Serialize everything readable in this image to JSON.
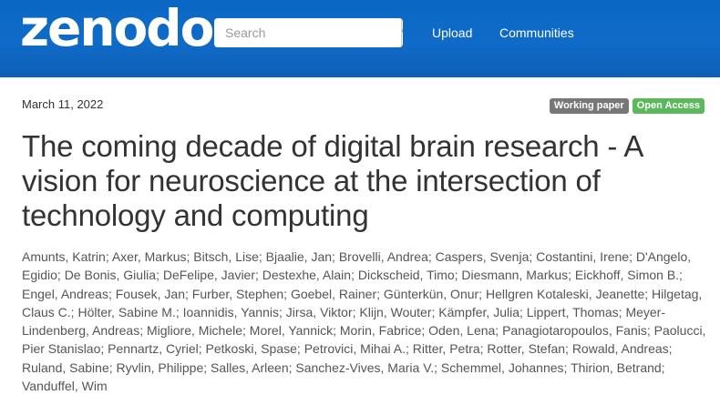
{
  "header": {
    "logo": "zenodo",
    "search": {
      "placeholder": "Search",
      "value": ""
    },
    "nav": [
      "Upload",
      "Communities"
    ]
  },
  "record": {
    "date": "March 11, 2022",
    "badges": [
      "Working paper",
      "Open Access"
    ],
    "title": "The coming decade of digital brain research - A vision for neuroscience at the intersection of technology and computing",
    "authors_text": "Amunts, Katrin; Axer, Markus; Bitsch, Lise; Bjaalie, Jan; Brovelli, Andrea; Caspers, Svenja; Costantini, Irene; D'Angelo, Egidio; De Bonis, Giulia; DeFelipe, Javier; Destexhe, Alain; Dickscheid, Timo; Diesmann, Markus; Eickhoff, Simon B.; Engel, Andreas; Fousek, Jan; Furber, Stephen; Goebel, Rainer; Günterkün, Onur; Hellgren Kotaleski, Jeanette; Hilgetag, Claus C.; Hölter, Sabine M.; Ioannidis, Yannis; Jirsa, Viktor; Klijn, Wouter; Kämpfer, Julia; Lippert, Thomas; Meyer-Lindenberg, Andreas; Migliore, Michele; Morel, Yannick; Morin, Fabrice; Oden, Lena; Panagiotaropoulos, Fanis; Paolucci, Pier Stanislao; Pennartz, Cyriel; Petkoski, Spase; Petrovici, Mihai A.; Ritter, Petra; Rotter, Stefan; Rowald, Andreas; Ruland, Sabine; Ryvlin, Philippe; Salles, Arleen; Sanchez-Vives, Maria V.; Schemmel, Johannes; Thirion, Betrand; Vanduffel, Wim"
  },
  "colors": {
    "header_bg": "#0f6bc7",
    "badge_type": "#777777",
    "badge_access": "#5cb85c",
    "title_text": "#333333"
  },
  "icons": {
    "search_button": "search-icon"
  }
}
